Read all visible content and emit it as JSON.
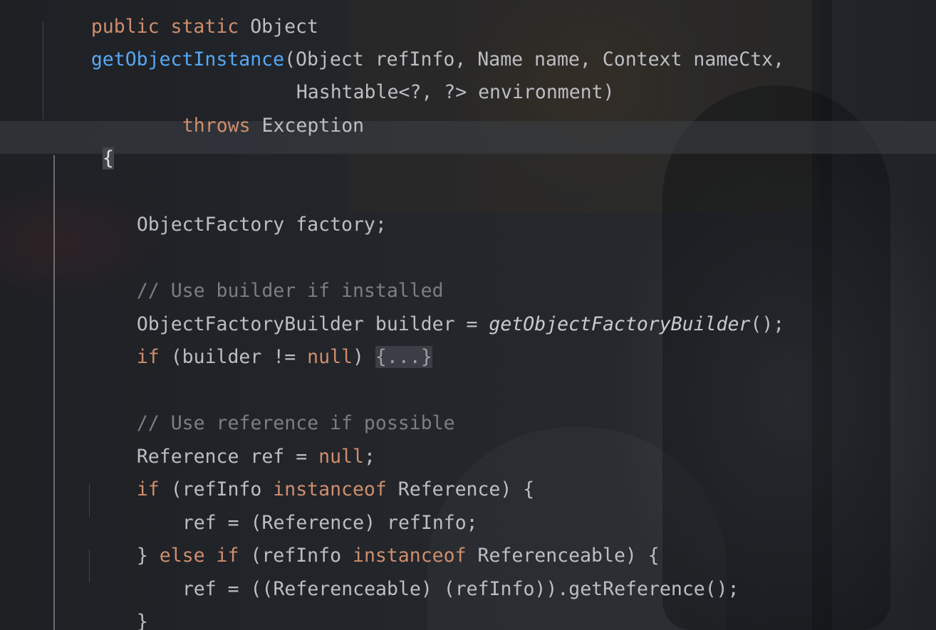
{
  "colors": {
    "keyword": "#cf8e6d",
    "method_declaration": "#56a8f5",
    "comment": "#7a7e85",
    "default_text": "#bcbec4",
    "fold_background": "#3b3f45"
  },
  "code": {
    "l1_kw": "public static",
    "l1_type": " Object",
    "l2_method": "getObjectInstance",
    "l2_params": "(Object refInfo, Name name, Context nameCtx,",
    "l3_params": "Hashtable<?, ?> environment)",
    "l4_kw": "throws",
    "l4_exc": " Exception",
    "l5_brace": "{",
    "l6_decl": "ObjectFactory factory;",
    "l7_comment": "// Use builder if installed",
    "l8_start": "ObjectFactoryBuilder builder = ",
    "l8_call": "getObjectFactoryBuilder",
    "l8_end": "();",
    "l9_if": "if",
    "l9_mid": " (builder != ",
    "l9_null": "null",
    "l9_close": ") ",
    "l9_fold": "{...}",
    "l10_comment": "// Use reference if possible",
    "l11_start": "Reference ref = ",
    "l11_null": "null",
    "l11_end": ";",
    "l12_if": "if",
    "l12_mid": " (refInfo ",
    "l12_instanceof": "instanceof",
    "l12_end": " Reference) {",
    "l13": "ref = (Reference) refInfo;",
    "l14_brace": "} ",
    "l14_else": "else if",
    "l14_mid": " (refInfo ",
    "l14_instanceof": "instanceof",
    "l14_end": " Referenceable) {",
    "l15": "ref = ((Referenceable) (refInfo)).getReference();",
    "l16": "}"
  }
}
